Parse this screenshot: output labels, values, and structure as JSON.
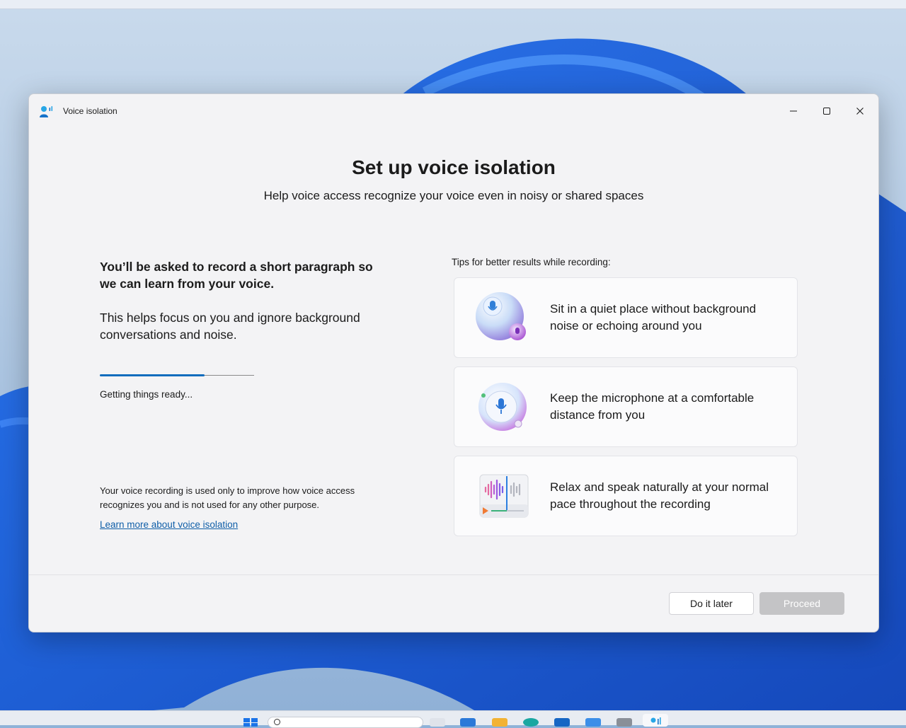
{
  "window": {
    "title": "Voice isolation"
  },
  "main": {
    "heading": "Set up voice isolation",
    "subheading": "Help voice access recognize your voice even in noisy or shared spaces",
    "lead": "You’ll be asked to record a short paragraph so we can learn from your voice.",
    "body": "This helps focus on you and ignore background conversations and noise.",
    "progress_fraction": 0.68,
    "status": "Getting things ready...",
    "privacy": "Your voice recording is used only to improve how voice access recognizes you and is not used for any other purpose.",
    "learn_more": "Learn more about voice isolation"
  },
  "tips": {
    "label": "Tips for better results while recording:",
    "items": [
      {
        "text": "Sit in a quiet place without background noise or echoing around you",
        "icon": "quiet-place-icon"
      },
      {
        "text": "Keep the microphone at a comfortable distance from you",
        "icon": "microphone-distance-icon"
      },
      {
        "text": "Relax and speak naturally at your normal pace throughout the recording",
        "icon": "waveform-icon"
      }
    ]
  },
  "footer": {
    "later_label": "Do it later",
    "proceed_label": "Proceed"
  },
  "colors": {
    "accent": "#0f6cbd",
    "disabled_button": "#c4c4c6",
    "link": "#0f5ea8"
  }
}
